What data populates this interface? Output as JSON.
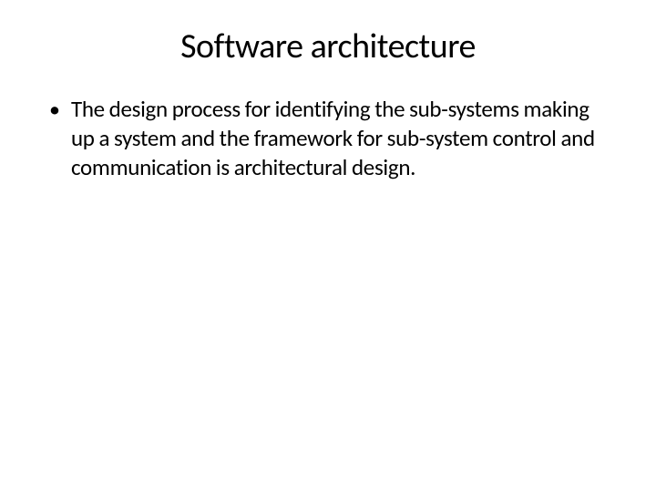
{
  "slide": {
    "title": "Software architecture",
    "bullets": [
      "The design process for identifying the sub-systems making up a system and the framework for sub-system control and communication is architectural design."
    ],
    "bullet_char": "•"
  }
}
